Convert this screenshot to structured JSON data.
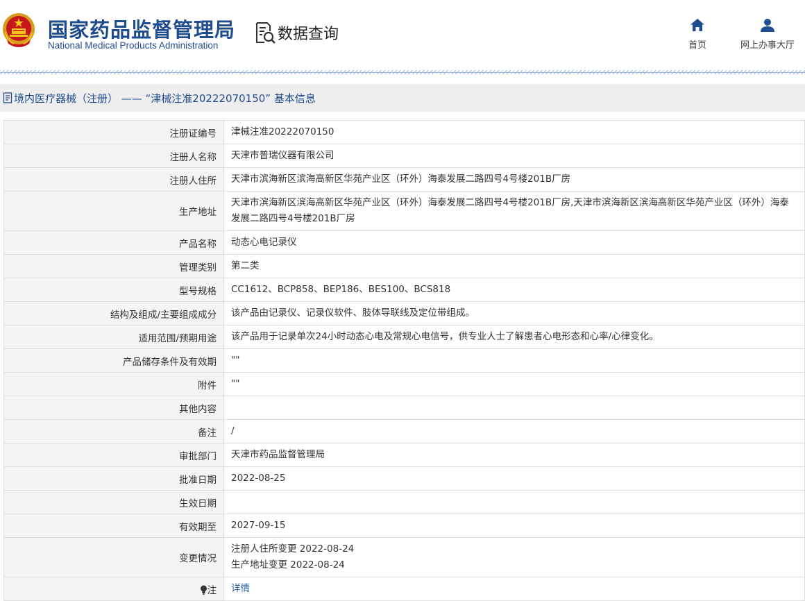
{
  "header": {
    "brand_cn": "国家药品监督管理局",
    "brand_en": "National Medical Products Administration",
    "data_query": "数据查询",
    "nav": [
      {
        "label": "首页",
        "icon": "home-icon"
      },
      {
        "label": "网上办事大厅",
        "icon": "user-icon"
      }
    ]
  },
  "page_title": "境内医疗器械（注册） —— “津械注准20222070150” 基本信息",
  "rows": [
    {
      "key": "注册证编号",
      "value": "津械注准20222070150"
    },
    {
      "key": "注册人名称",
      "value": "天津市普瑞仪器有限公司"
    },
    {
      "key": "注册人住所",
      "value": "天津市滨海新区滨海高新区华苑产业区（环外）海泰发展二路四号4号楼201B厂房"
    },
    {
      "key": "生产地址",
      "value": "天津市滨海新区滨海高新区华苑产业区（环外）海泰发展二路四号4号楼201B厂房,天津市滨海新区滨海高新区华苑产业区（环外）海泰发展二路四号4号楼201B厂房"
    },
    {
      "key": "产品名称",
      "value": "动态心电记录仪"
    },
    {
      "key": "管理类别",
      "value": "第二类"
    },
    {
      "key": "型号规格",
      "value": "CC1612、BCP858、BEP186、BES100、BCS818"
    },
    {
      "key": "结构及组成/主要组成成分",
      "value": "该产品由记录仪、记录仪软件、肢体导联线及定位带组成。"
    },
    {
      "key": "适用范围/预期用途",
      "value": "该产品用于记录单次24小时动态心电及常规心电信号，供专业人士了解患者心电形态和心率/心律变化。"
    },
    {
      "key": "产品储存条件及有效期",
      "value": "\"\""
    },
    {
      "key": "附件",
      "value": "\"\""
    },
    {
      "key": "其他内容",
      "value": ""
    },
    {
      "key": "备注",
      "value": "/"
    },
    {
      "key": "审批部门",
      "value": "天津市药品监督管理局"
    },
    {
      "key": "批准日期",
      "value": "2022-08-25"
    },
    {
      "key": "生效日期",
      "value": ""
    },
    {
      "key": "有效期至",
      "value": "2027-09-15"
    },
    {
      "key": "变更情况",
      "value_lines": [
        "注册人住所变更 2022-08-24",
        "生产地址变更 2022-08-24"
      ]
    },
    {
      "key": "注",
      "value": "详情",
      "icon": "lightbulb-icon"
    }
  ]
}
